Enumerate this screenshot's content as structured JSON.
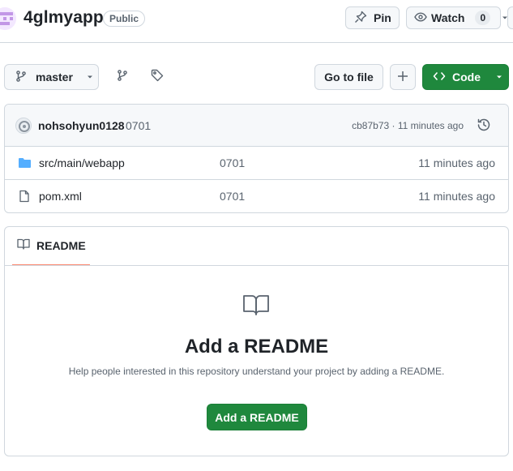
{
  "header": {
    "repo_name": "4glmyapp",
    "visibility": "Public",
    "pin_label": "Pin",
    "watch_label": "Watch",
    "watch_count": "0"
  },
  "toolbar": {
    "branch": "master",
    "goto_file": "Go to file",
    "code_label": "Code"
  },
  "commit": {
    "author": "nohsohyun0128",
    "message": "0701",
    "meta": "cb87b73 · 11 minutes ago"
  },
  "files": [
    {
      "name": "src/main/webapp",
      "type": "folder",
      "commit": "0701",
      "time": "11 minutes ago"
    },
    {
      "name": "pom.xml",
      "type": "file",
      "commit": "0701",
      "time": "11 minutes ago"
    }
  ],
  "readme": {
    "tab_label": "README",
    "heading": "Add a README",
    "description": "Help people interested in this repository understand your project by adding a README.",
    "button_label": "Add a README"
  },
  "colors": {
    "primary_green": "#1f883d",
    "folder_blue": "#54aeff",
    "tab_underline": "#fd8c73"
  }
}
